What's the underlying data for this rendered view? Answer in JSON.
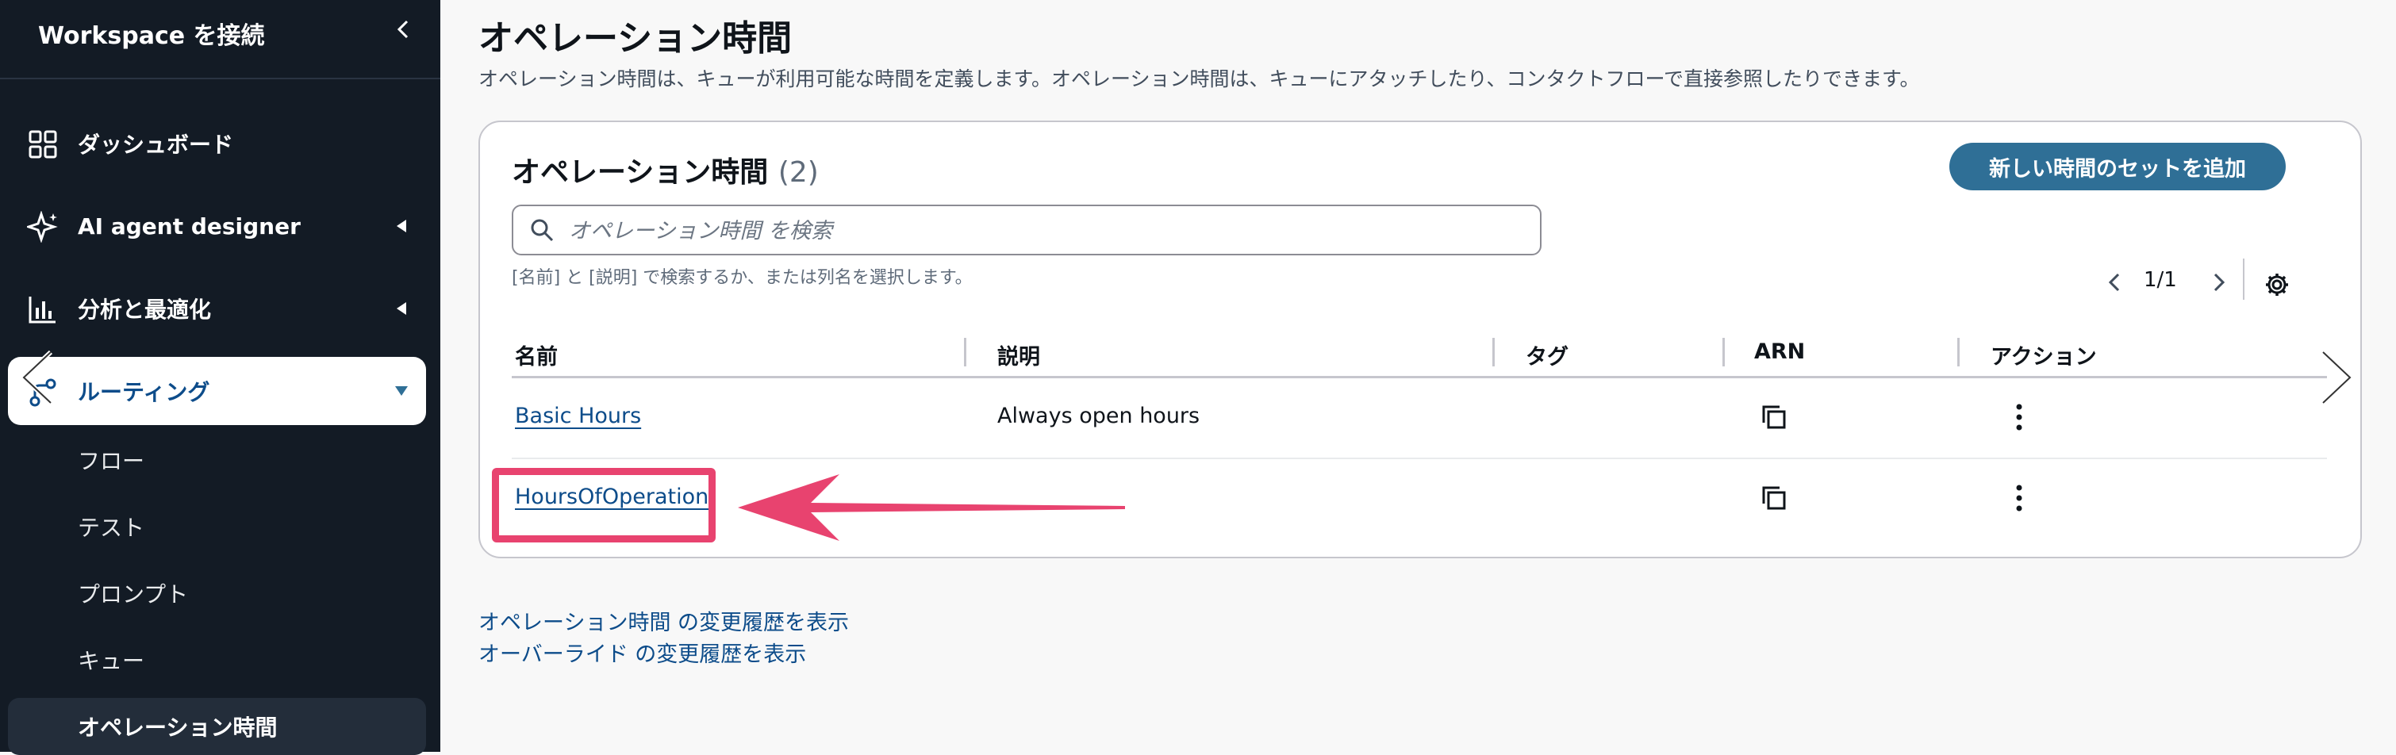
{
  "sidebar": {
    "title": "Workspace を接続",
    "nav": [
      {
        "label": "ダッシュボード",
        "icon": "dashboard-icon"
      },
      {
        "label": "AI agent designer",
        "icon": "sparkle-icon"
      },
      {
        "label": "分析と最適化",
        "icon": "bar-chart-icon"
      },
      {
        "label": "ルーティング",
        "icon": "routing-icon"
      }
    ],
    "sub_items": [
      "フロー",
      "テスト",
      "プロンプト",
      "キュー"
    ],
    "active_sub": "オペレーション時間"
  },
  "main": {
    "title": "オペレーション時間",
    "description": "オペレーション時間は、キューが利用可能な時間を定義します。オペレーション時間は、キューにアタッチしたり、コンタクトフローで直接参照したりできます。",
    "card": {
      "title": "オペレーション時間",
      "count": "(2)",
      "add_button": "新しい時間のセットを追加",
      "search_placeholder": "オペレーション時間 を検索",
      "search_hint": "[名前] と [説明] で検索するか、または列名を選択します。",
      "page": "1/1",
      "columns": [
        "名前",
        "説明",
        "タグ",
        "ARN",
        "アクション"
      ],
      "rows": [
        {
          "name": "Basic Hours",
          "description": "Always open hours",
          "tags": ""
        },
        {
          "name": "HoursOfOperation",
          "description": "",
          "tags": ""
        }
      ]
    },
    "links": [
      "オペレーション時間 の変更履歴を表示",
      "オーバーライド の変更履歴を表示"
    ]
  },
  "colors": {
    "sidebar_bg": "#131b25",
    "accent": "#2f6f96",
    "link": "#0d4c8a",
    "highlight": "#e8436f"
  }
}
